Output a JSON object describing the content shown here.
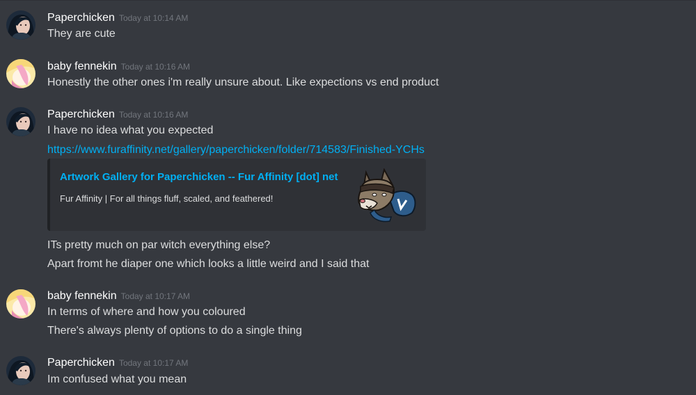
{
  "messages": [
    {
      "username": "Paperchicken",
      "timestamp": "Today at 10:14 AM",
      "lines": [
        "They are cute"
      ]
    },
    {
      "username": "baby fennekin",
      "timestamp": "Today at 10:16 AM",
      "lines": [
        "Honestly the other ones i'm really unsure about. Like expections vs end product"
      ]
    },
    {
      "username": "Paperchicken",
      "timestamp": "Today at 10:16 AM",
      "lines": [
        "I have no idea what you expected"
      ],
      "link": "https://www.furaffinity.net/gallery/paperchicken/folder/714583/Finished-YCHs",
      "embed": {
        "title": "Artwork Gallery for Paperchicken -- Fur Affinity [dot] net",
        "description": "Fur Affinity | For all things fluff, scaled, and feathered!",
        "thumbnail_icon": "fur-affinity-fox-mascot-icon"
      },
      "more_lines": [
        "ITs pretty much on par witch everything else?",
        "Apart fromt he diaper one which looks a little weird and I said that"
      ]
    },
    {
      "username": "baby fennekin",
      "timestamp": "Today at 10:17 AM",
      "lines": [
        "In terms of where and how you coloured",
        "There's always plenty of options to do a single thing"
      ]
    },
    {
      "username": "Paperchicken",
      "timestamp": "Today at 10:17 AM",
      "lines": [
        "Im confused what you mean"
      ]
    }
  ],
  "colors": {
    "background": "#36393f",
    "username": "#ffffff",
    "timestamp": "#72767d",
    "message_text": "#dcddde",
    "link": "#00b0f4",
    "embed_background": "#2f3136",
    "embed_border": "#202225"
  }
}
